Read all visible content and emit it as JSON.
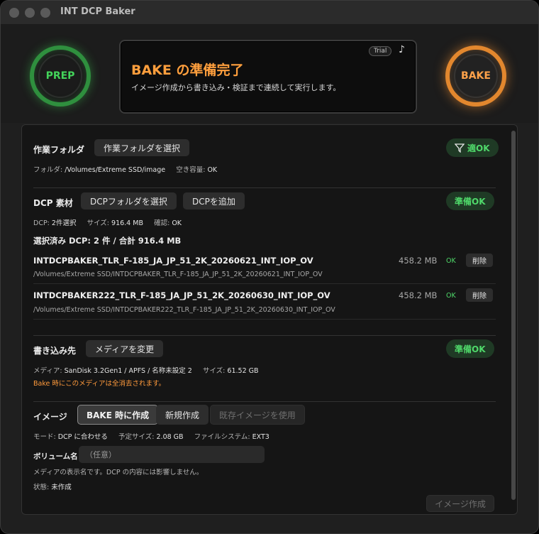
{
  "window": {
    "title": "INT DCP Baker"
  },
  "header": {
    "prep_label": "PREP",
    "bake_label": "BAKE",
    "status_title": "BAKE の準備完了",
    "status_sub": "イメージ作成から書き込み・検証まで連続して実行します。",
    "trial_badge": "Trial",
    "music_icon": "♪"
  },
  "work_folder": {
    "label": "作業フォルダ",
    "select_button": "作業フォルダを選択",
    "status": "適OK",
    "folder_key": "フォルダ:",
    "folder_value": "/Volumes/Extreme SSD/image",
    "free_key": "空き容量:",
    "free_value": "OK"
  },
  "dcp": {
    "label": "DCP 素材",
    "select_button": "DCPフォルダを選択",
    "add_button": "DCPを追加",
    "status": "準備OK",
    "dcp_key": "DCP:",
    "dcp_value": "2件選択",
    "size_key": "サイズ:",
    "size_value": "916.4 MB",
    "check_key": "確認:",
    "check_value": "OK",
    "summary": "選択済み DCP: 2 件 / 合計 916.4 MB",
    "items": [
      {
        "name": "INTDCPBAKER_TLR_F-185_JA_JP_51_2K_20260621_INT_IOP_OV",
        "path": "/Volumes/Extreme SSD/INTDCPBAKER_TLR_F-185_JA_JP_51_2K_20260621_INT_IOP_OV",
        "size": "458.2 MB",
        "status": "OK",
        "delete": "削除"
      },
      {
        "name": "INTDCPBAKER222_TLR_F-185_JA_JP_51_2K_20260630_INT_IOP_OV",
        "path": "/Volumes/Extreme SSD/INTDCPBAKER222_TLR_F-185_JA_JP_51_2K_20260630_INT_IOP_OV",
        "size": "458.2 MB",
        "status": "OK",
        "delete": "削除"
      }
    ]
  },
  "destination": {
    "label": "書き込み先",
    "change_button": "メディアを変更",
    "status": "準備OK",
    "media_key": "メディア:",
    "media_value": "SanDisk 3.2Gen1 / APFS / 名称未設定 2",
    "size_key": "サイズ:",
    "size_value": "61.52 GB",
    "warning": "Bake 時にこのメディアは全消去されます。"
  },
  "image": {
    "label": "イメージ",
    "options": [
      "BAKE 時に作成",
      "新規作成",
      "既存イメージを使用"
    ],
    "mode_key": "モード:",
    "mode_value": "DCP に合わせる",
    "est_key": "予定サイズ:",
    "est_value": "2.08 GB",
    "fs_key": "ファイルシステム:",
    "fs_value": "EXT3",
    "volume_label": "ボリューム名",
    "volume_placeholder": "（任意）",
    "volume_note": "メディアの表示名です。DCP の内容には影響しません。",
    "state_key": "状態:",
    "state_value": "未作成",
    "create_button": "イメージ作成"
  },
  "colors": {
    "accent_orange": "#ff9f3d",
    "ok_green": "#4fd96a",
    "prep_green": "#2f8f3e"
  }
}
